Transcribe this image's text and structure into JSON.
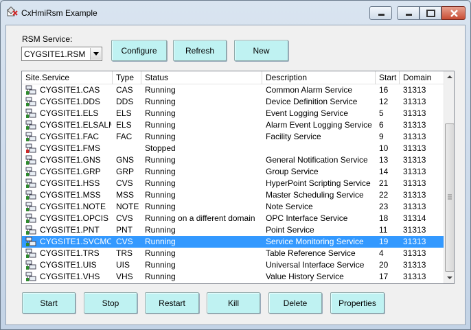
{
  "window": {
    "title": "CxHmiRsm Example"
  },
  "rsm": {
    "label": "RSM Service:",
    "selected": "CYGSITE1.RSM"
  },
  "top_buttons": {
    "configure": "Configure",
    "refresh": "Refresh",
    "new": "New"
  },
  "columns": [
    "Site.Service",
    "Type",
    "Status",
    "Description",
    "Start",
    "Domain"
  ],
  "rows": [
    {
      "site": "CYGSITE1.CAS",
      "type": "CAS",
      "status": "Running",
      "desc": "Common Alarm Service",
      "start": "16",
      "domain": "31313"
    },
    {
      "site": "CYGSITE1.DDS",
      "type": "DDS",
      "status": "Running",
      "desc": "Device Definition Service",
      "start": "12",
      "domain": "31313"
    },
    {
      "site": "CYGSITE1.ELS",
      "type": "ELS",
      "status": "Running",
      "desc": "Event Logging Service",
      "start": "5",
      "domain": "31313"
    },
    {
      "site": "CYGSITE1.ELSALM",
      "type": "ELS",
      "status": "Running",
      "desc": "Alarm Event Logging Service",
      "start": "6",
      "domain": "31313"
    },
    {
      "site": "CYGSITE1.FAC",
      "type": "FAC",
      "status": "Running",
      "desc": "Facility Service",
      "start": "9",
      "domain": "31313"
    },
    {
      "site": "CYGSITE1.FMS",
      "type": "",
      "status": "Stopped",
      "desc": "",
      "start": "10",
      "domain": "31313"
    },
    {
      "site": "CYGSITE1.GNS",
      "type": "GNS",
      "status": "Running",
      "desc": "General Notification Service",
      "start": "13",
      "domain": "31313"
    },
    {
      "site": "CYGSITE1.GRP",
      "type": "GRP",
      "status": "Running",
      "desc": "Group Service",
      "start": "14",
      "domain": "31313"
    },
    {
      "site": "CYGSITE1.HSS",
      "type": "CVS",
      "status": "Running",
      "desc": "HyperPoint Scripting Service",
      "start": "21",
      "domain": "31313"
    },
    {
      "site": "CYGSITE1.MSS",
      "type": "MSS",
      "status": "Running",
      "desc": "Master Scheduling Service",
      "start": "22",
      "domain": "31313"
    },
    {
      "site": "CYGSITE1.NOTE",
      "type": "NOTE",
      "status": "Running",
      "desc": "Note Service",
      "start": "23",
      "domain": "31313"
    },
    {
      "site": "CYGSITE1.OPCIS",
      "type": "CVS",
      "status": "Running on a different domain",
      "desc": "OPC Interface Service",
      "start": "18",
      "domain": "31314"
    },
    {
      "site": "CYGSITE1.PNT",
      "type": "PNT",
      "status": "Running",
      "desc": "Point Service",
      "start": "11",
      "domain": "31313"
    },
    {
      "site": "CYGSITE1.SVCMON",
      "type": "CVS",
      "status": "Running",
      "desc": "Service Monitoring Service",
      "start": "19",
      "domain": "31313",
      "selected": true
    },
    {
      "site": "CYGSITE1.TRS",
      "type": "TRS",
      "status": "Running",
      "desc": "Table Reference Service",
      "start": "4",
      "domain": "31313"
    },
    {
      "site": "CYGSITE1.UIS",
      "type": "UIS",
      "status": "Running",
      "desc": "Universal Interface Service",
      "start": "20",
      "domain": "31313"
    },
    {
      "site": "CYGSITE1.VHS",
      "type": "VHS",
      "status": "Running",
      "desc": "Value History Service",
      "start": "17",
      "domain": "31313"
    }
  ],
  "bottom_buttons": {
    "start": "Start",
    "stop": "Stop",
    "restart": "Restart",
    "kill": "Kill",
    "delete": "Delete",
    "properties": "Properties"
  },
  "colors": {
    "selection": "#3399ff",
    "button_face": "#bff2f2",
    "running_icon": "#2e8b2e",
    "stopped_icon": "#cc2a2a"
  },
  "icons": {
    "service_running": "service-running-icon",
    "service_stopped": "service-stopped-icon"
  }
}
